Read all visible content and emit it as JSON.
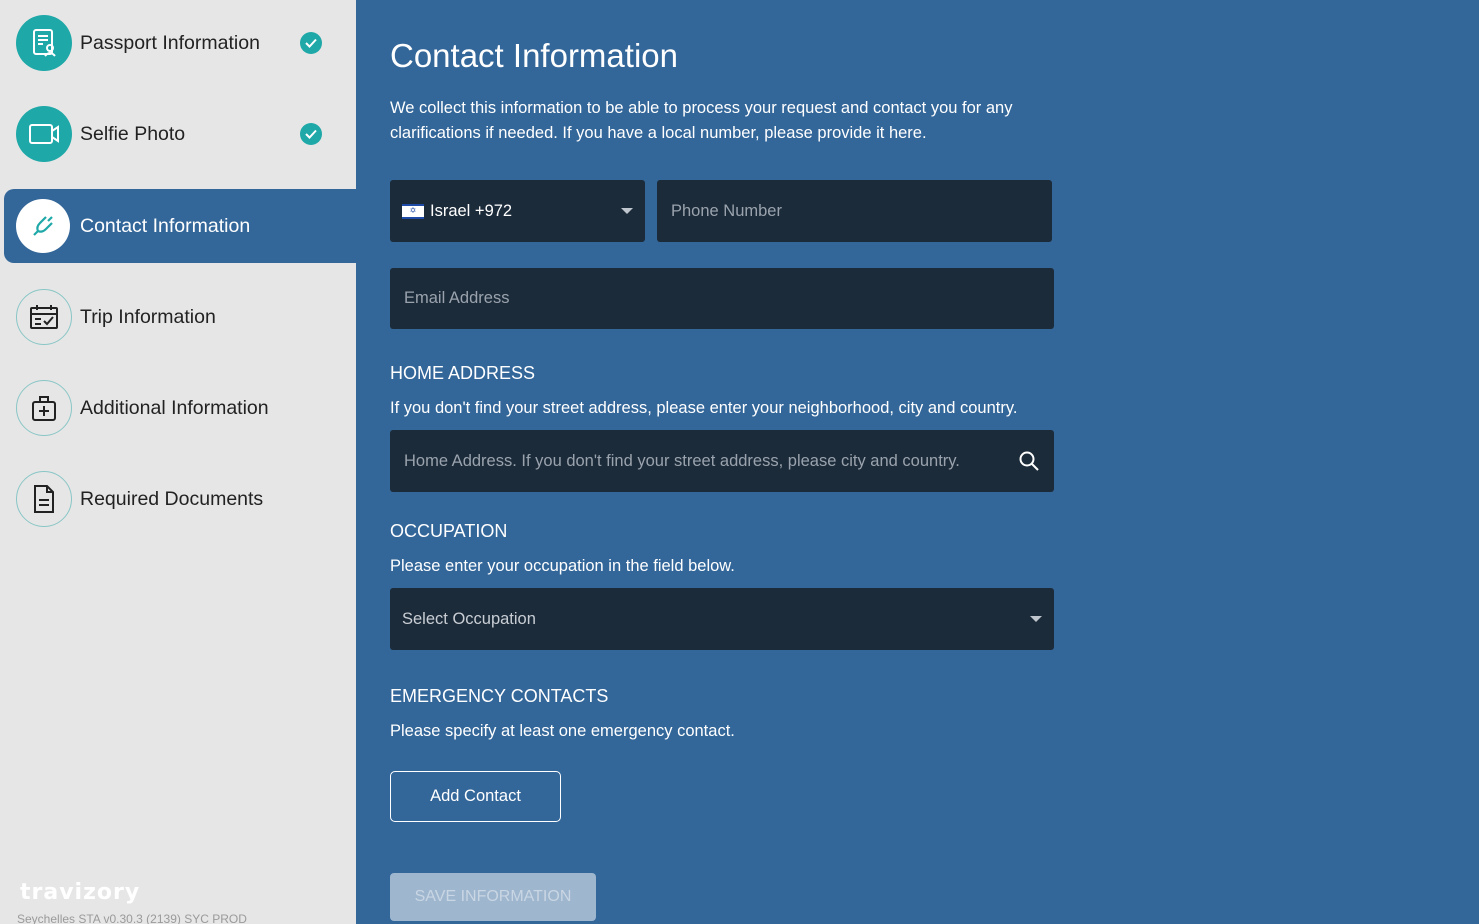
{
  "sidebar": {
    "steps": [
      {
        "label": "Passport Information",
        "status": "done",
        "icon": "passport-icon"
      },
      {
        "label": "Selfie Photo",
        "status": "done",
        "icon": "camera-icon"
      },
      {
        "label": "Contact Information",
        "status": "current",
        "icon": "phone-icon"
      },
      {
        "label": "Trip Information",
        "status": "todo",
        "icon": "calendar-icon"
      },
      {
        "label": "Additional Information",
        "status": "todo",
        "icon": "medical-bag-icon"
      },
      {
        "label": "Required Documents",
        "status": "todo",
        "icon": "document-icon"
      }
    ],
    "brand": "travizory",
    "version": "Seychelles STA v0.30.3 (2139) SYC PROD"
  },
  "main": {
    "title": "Contact Information",
    "intro": "We collect this information to be able to process your request and contact you for any clarifications if needed. If you have a local number, please provide it here.",
    "country_select": {
      "value": "Israel +972"
    },
    "phone": {
      "placeholder": "Phone Number"
    },
    "email": {
      "placeholder": "Email Address"
    },
    "home_address": {
      "heading": "HOME ADDRESS",
      "hint": "If you don't find your street address, please enter your neighborhood, city and country.",
      "placeholder": "Home Address. If you don't find your street address, please city and country."
    },
    "occupation": {
      "heading": "OCCUPATION",
      "hint": "Please enter your occupation in the field below.",
      "placeholder": "Select Occupation"
    },
    "emergency": {
      "heading": "EMERGENCY CONTACTS",
      "hint": "Please specify at least one emergency contact.",
      "add_label": "Add Contact"
    },
    "save_label": "SAVE INFORMATION"
  },
  "colors": {
    "page_bg": "#336699",
    "sidebar_bg": "#e6e6e6",
    "accent": "#1fa8a8",
    "field_bg": "#1c2b3a"
  }
}
